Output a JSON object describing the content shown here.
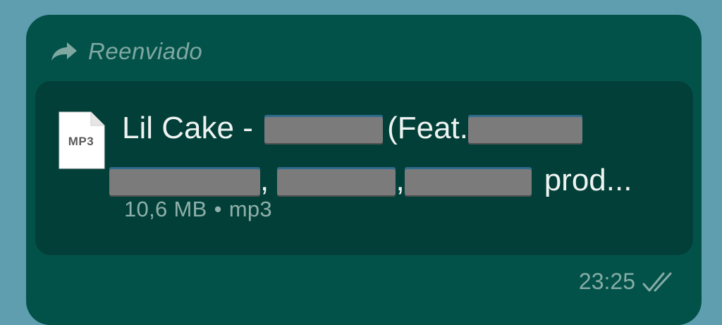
{
  "message": {
    "forwarded_label": "Reenviado",
    "file": {
      "extension": "MP3",
      "title_line1_prefix": "Lil Cake -",
      "title_line1_mid": "(Feat.",
      "title_line2_sep1": ",",
      "title_line2_sep2": ",",
      "title_line2_suffix": "prod...",
      "size": "10,6 MB",
      "separator": "•",
      "type": "mp3"
    },
    "time": "23:25",
    "status_icon": "double-check-icon"
  },
  "colors": {
    "background": "#5e9eaf",
    "bubble": "#03524a",
    "card": "#023f38",
    "text": "#eef3f1",
    "muted": "#8fb0aa"
  }
}
